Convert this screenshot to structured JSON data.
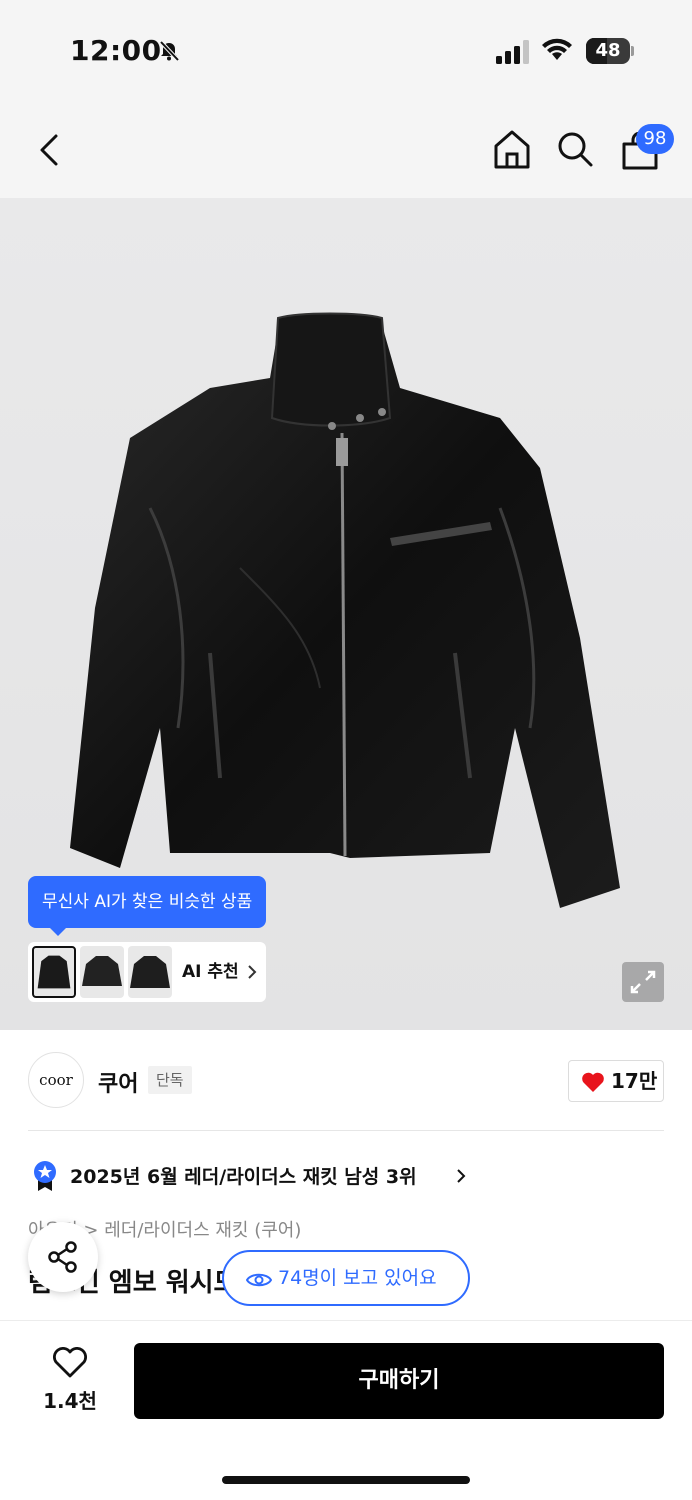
{
  "status_bar": {
    "time": "12:00",
    "battery_level": "48",
    "icons": [
      "bell-muted-icon",
      "signal-icon",
      "wifi-icon",
      "battery-icon"
    ]
  },
  "nav": {
    "icons": [
      "back-icon",
      "home-icon",
      "search-icon",
      "cart-icon"
    ],
    "cart_badge": "98"
  },
  "ai": {
    "tooltip": "무신사 AI가 찾은 비슷한 상품",
    "label": "AI 추천"
  },
  "brand": {
    "logo_text": "coor",
    "name": "쿠어",
    "badge": "단독",
    "likes": "17만"
  },
  "ranking": {
    "text": "2025년 6월 레더/라이더스 재킷 남성 3위"
  },
  "breadcrumb": {
    "text": "아우터 > 레더/라이더스 재킷 (쿠어)"
  },
  "product": {
    "title": "램스킨 엠보 워시드 라이더 재킷 (블랙)"
  },
  "viewers": {
    "text": "74명이 보고 있어요"
  },
  "bottom": {
    "wish_count": "1.4천",
    "buy_label": "구매하기"
  },
  "colors": {
    "accent": "#2f6bff",
    "heart": "#e8141c",
    "buy_bg": "#000000"
  }
}
